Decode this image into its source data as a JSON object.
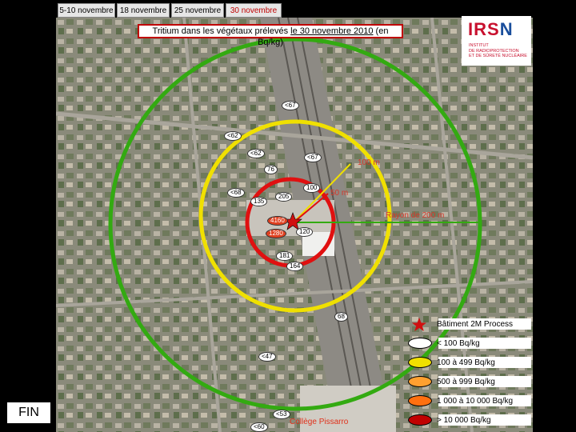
{
  "tabs": [
    {
      "label": "5-10 novembre",
      "active": false
    },
    {
      "label": "18 novembre",
      "active": false
    },
    {
      "label": "25 novembre",
      "active": false
    },
    {
      "label": "30 novembre",
      "active": true
    }
  ],
  "title": {
    "before": "Tritium dans les végétaux prélevés ",
    "underlined": "le 30 novembre 2010",
    "after": " (en Bq/kg)"
  },
  "logo": {
    "brand_left": "IRS",
    "brand_right": "N",
    "sub_lines": [
      "INSTITUT",
      "DE RADIOPROTECTION",
      "ET DE SÛRETÉ NUCLÉAIRE"
    ]
  },
  "rings": {
    "labels": [
      "100 m",
      "50 m",
      "Rayon de 200 m"
    ],
    "colors": {
      "outer": "#33aa11",
      "middle": "#f0e000",
      "inner": "#e01010"
    }
  },
  "samples": [
    {
      "text": "<67",
      "level": "white"
    },
    {
      "text": "<62",
      "level": "white"
    },
    {
      "text": "<62",
      "level": "white"
    },
    {
      "text": "<67",
      "level": "white"
    },
    {
      "text": "76",
      "level": "white"
    },
    {
      "text": "<68",
      "level": "white"
    },
    {
      "text": "135",
      "level": "white"
    },
    {
      "text": "205",
      "level": "white"
    },
    {
      "text": "100",
      "level": "white"
    },
    {
      "text": "4160",
      "level": "red"
    },
    {
      "text": "1280",
      "level": "red"
    },
    {
      "text": "120",
      "level": "white"
    },
    {
      "text": "181",
      "level": "white"
    },
    {
      "text": "164",
      "level": "white"
    },
    {
      "text": "68",
      "level": "white"
    },
    {
      "text": "<47",
      "level": "white"
    },
    {
      "text": "<53",
      "level": "white"
    },
    {
      "text": "<60",
      "level": "white"
    }
  ],
  "school_label": "Collège Pissarro",
  "legend": {
    "building": "Bâtiment 2M Process",
    "items": [
      {
        "label": "< 100 Bq/kg",
        "color": "#ffffff"
      },
      {
        "label": "100 à 499 Bq/kg",
        "color": "#f0e000"
      },
      {
        "label": "500 à 999 Bq/kg",
        "color": "#ffa030"
      },
      {
        "label": "1 000 à 10 000 Bq/kg",
        "color": "#ff7010"
      },
      {
        "label": "> 10 000 Bq/kg",
        "color": "#c00000"
      }
    ],
    "star_color": "#d01010"
  },
  "fin_label": "FIN"
}
